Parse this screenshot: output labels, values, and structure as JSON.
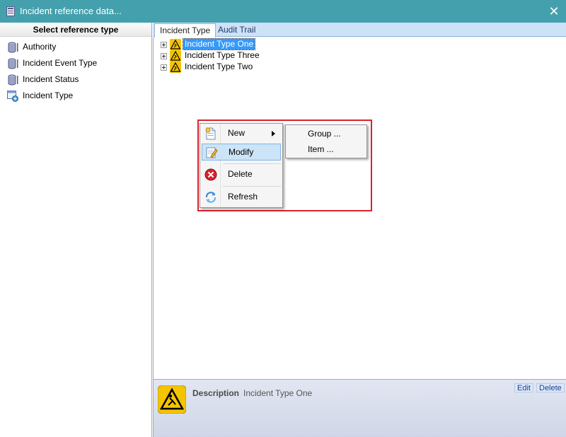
{
  "window": {
    "title": "Incident reference data..."
  },
  "left_panel": {
    "header": "Select reference type",
    "items": [
      {
        "label": "Authority",
        "icon": "database-icon"
      },
      {
        "label": "Incident Event Type",
        "icon": "database-icon"
      },
      {
        "label": "Incident Status",
        "icon": "database-icon"
      },
      {
        "label": "Incident Type",
        "icon": "tree-table-icon"
      }
    ]
  },
  "tabs": [
    {
      "label": "Incident Type",
      "active": true
    },
    {
      "label": "Audit Trail",
      "active": false
    }
  ],
  "tree": {
    "items": [
      {
        "label": "Incident Type One",
        "selected": true
      },
      {
        "label": "Incident Type Three",
        "selected": false
      },
      {
        "label": "Incident Type Two",
        "selected": false
      }
    ]
  },
  "context_menu": {
    "items": [
      {
        "label": "New",
        "icon": "new-document-icon",
        "has_submenu": true
      },
      {
        "label": "Modify",
        "icon": "edit-icon",
        "hover": true
      },
      {
        "label": "Delete",
        "icon": "delete-icon"
      },
      {
        "label": "Refresh",
        "icon": "refresh-icon"
      }
    ],
    "submenu": [
      {
        "label": "Group ..."
      },
      {
        "label": "Item ..."
      }
    ]
  },
  "description": {
    "label": "Description",
    "value": "Incident Type One",
    "edit_label": "Edit",
    "delete_label": "Delete"
  },
  "colors": {
    "titlebar": "#45a0ad",
    "selection": "#3399ff",
    "highlight_box": "#d9232e",
    "warning_icon": "#f5c400"
  }
}
